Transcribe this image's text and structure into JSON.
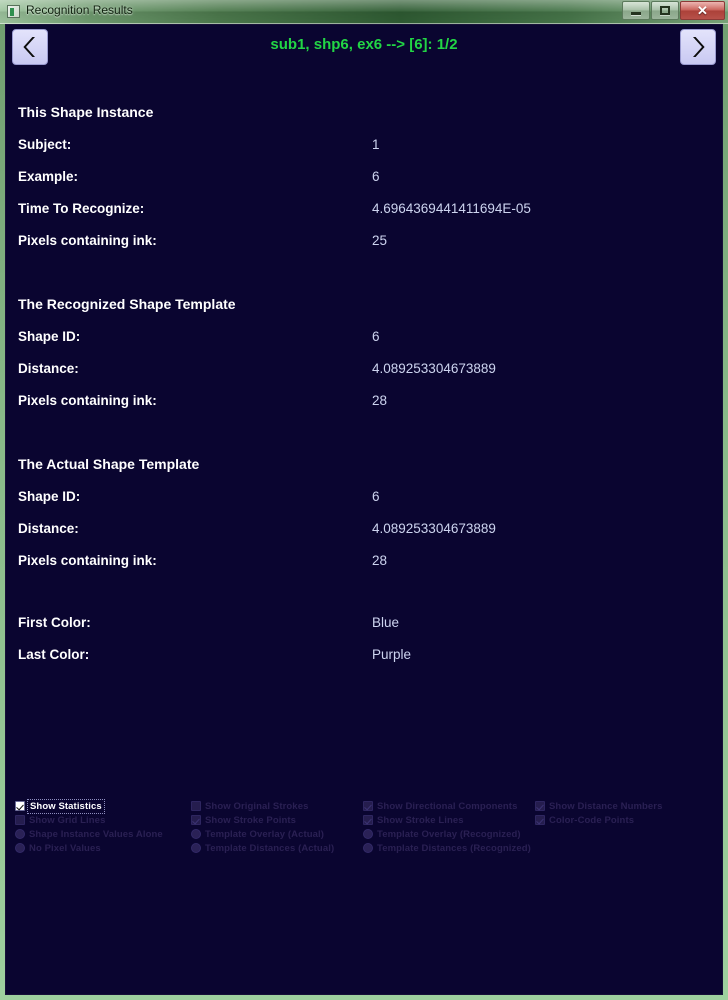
{
  "window": {
    "title": "Recognition Results",
    "icon": "app-icon",
    "controls": {
      "minimize": "–",
      "maximize": "□",
      "close": "✕"
    }
  },
  "nav": {
    "prev_icon": "chevron-left-icon",
    "next_icon": "chevron-right-icon",
    "title": "sub1, shp6, ex6 --> [6]: 1/2",
    "title_color": "#22d645"
  },
  "sections": [
    {
      "heading": "This Shape Instance",
      "rows": [
        {
          "label": "Subject:",
          "value": "1"
        },
        {
          "label": "Example:",
          "value": "6"
        },
        {
          "label": "Time To Recognize:",
          "value": "4.6964369441411694E-05"
        },
        {
          "label": "Pixels containing ink:",
          "value": "25"
        }
      ]
    },
    {
      "heading": "The Recognized Shape Template",
      "rows": [
        {
          "label": "Shape ID:",
          "value": "6"
        },
        {
          "label": "Distance:",
          "value": "4.089253304673889"
        },
        {
          "label": "Pixels containing ink:",
          "value": "28"
        }
      ]
    },
    {
      "heading": "The Actual Shape Template",
      "rows": [
        {
          "label": "Shape ID:",
          "value": "6"
        },
        {
          "label": "Distance:",
          "value": "4.089253304673889"
        },
        {
          "label": "Pixels containing ink:",
          "value": "28"
        }
      ]
    }
  ],
  "colors": {
    "rows": [
      {
        "label": "First Color:",
        "value": "Blue"
      },
      {
        "label": "Last Color:",
        "value": "Purple"
      }
    ]
  },
  "options": {
    "columns": [
      {
        "items": [
          {
            "type": "checkbox",
            "label": "Show Statistics",
            "checked": true,
            "enabled": true
          },
          {
            "type": "checkbox",
            "label": "Show Grid Lines",
            "checked": false,
            "enabled": false
          },
          {
            "type": "radio",
            "label": "Shape Instance Values Alone",
            "checked": false,
            "enabled": false
          },
          {
            "type": "radio",
            "label": "No Pixel Values",
            "checked": false,
            "enabled": false
          }
        ]
      },
      {
        "items": [
          {
            "type": "checkbox",
            "label": "Show Original Strokes",
            "checked": false,
            "enabled": false
          },
          {
            "type": "checkbox",
            "label": "Show Stroke Points",
            "checked": true,
            "enabled": false
          },
          {
            "type": "radio",
            "label": "Template Overlay (Actual)",
            "checked": false,
            "enabled": false
          },
          {
            "type": "radio",
            "label": "Template Distances (Actual)",
            "checked": false,
            "enabled": false
          }
        ]
      },
      {
        "items": [
          {
            "type": "checkbox",
            "label": "Show Directional Components",
            "checked": true,
            "enabled": false
          },
          {
            "type": "checkbox",
            "label": "Show Stroke Lines",
            "checked": true,
            "enabled": false
          },
          {
            "type": "radio",
            "label": "Template Overlay (Recognized)",
            "checked": false,
            "enabled": false
          },
          {
            "type": "radio",
            "label": "Template Distances (Recognized)",
            "checked": false,
            "enabled": false
          }
        ]
      },
      {
        "items": [
          {
            "type": "checkbox",
            "label": "Show Distance Numbers",
            "checked": true,
            "enabled": false
          },
          {
            "type": "checkbox",
            "label": "Color-Code Points",
            "checked": true,
            "enabled": false
          }
        ]
      }
    ]
  }
}
